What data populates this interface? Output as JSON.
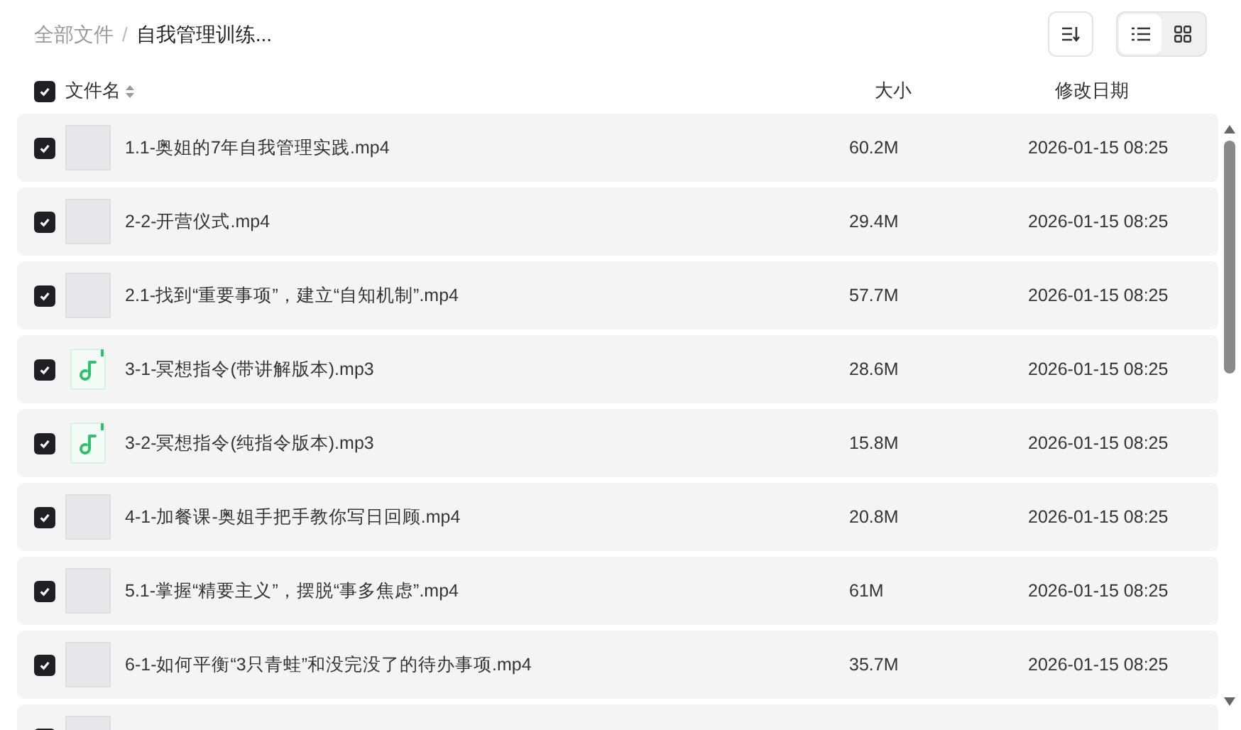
{
  "breadcrumb_separator": "/",
  "breadcrumb": [
    {
      "label": "全部文件",
      "current": false
    },
    {
      "label": "自我管理训练...",
      "current": true
    }
  ],
  "view_toggle": [
    {
      "kind": "list",
      "selected": true
    },
    {
      "kind": "grid",
      "selected": false
    }
  ],
  "header": {
    "checked": true,
    "columns": [
      "文件名",
      "大小",
      "修改日期"
    ]
  },
  "rows": [
    {
      "kind": "video",
      "checked": true,
      "name": "1.1-奥姐的7年自我管理实践.mp4",
      "size": "60.2M",
      "date": "2026-01-15 08:25"
    },
    {
      "kind": "video",
      "checked": true,
      "name": "2-2-开营仪式.mp4",
      "size": "29.4M",
      "date": "2026-01-15 08:25"
    },
    {
      "kind": "video",
      "checked": true,
      "name": "2.1-找到“重要事项”，建立“自知机制”.mp4",
      "size": "57.7M",
      "date": "2026-01-15 08:25"
    },
    {
      "kind": "audio",
      "checked": true,
      "name": "3-1-冥想指令(带讲解版本).mp3",
      "size": "28.6M",
      "date": "2026-01-15 08:25"
    },
    {
      "kind": "audio",
      "checked": true,
      "name": "3-2-冥想指令(纯指令版本).mp3",
      "size": "15.8M",
      "date": "2026-01-15 08:25"
    },
    {
      "kind": "video",
      "checked": true,
      "name": "4-1-加餐课-奥姐手把手教你写日回顾.mp4",
      "size": "20.8M",
      "date": "2026-01-15 08:25"
    },
    {
      "kind": "video",
      "checked": true,
      "name": "5.1-掌握“精要主义”，摆脱“事多焦虑”.mp4",
      "size": "61M",
      "date": "2026-01-15 08:25"
    },
    {
      "kind": "video",
      "checked": true,
      "name": "6-1-如何平衡“3只青蛙”和没完没了的待办事项.mp4",
      "size": "35.7M",
      "date": "2026-01-15 08:25"
    },
    {
      "kind": "video",
      "checked": true
    }
  ]
}
